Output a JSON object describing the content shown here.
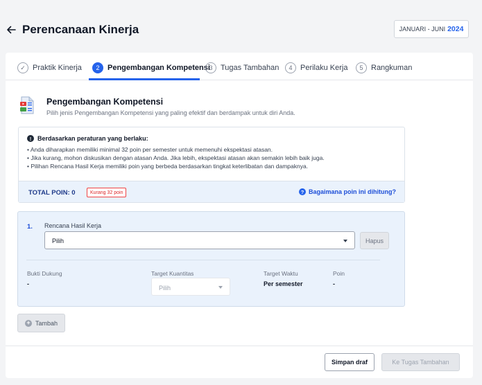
{
  "header": {
    "title": "Perencanaan Kinerja",
    "period_label": "JANUARI - JUNI",
    "period_year": "2024"
  },
  "steps": [
    {
      "marker": "✓",
      "label": "Praktik Kinerja",
      "state": "done"
    },
    {
      "marker": "2",
      "label": "Pengembangan Kompetensi",
      "state": "active"
    },
    {
      "marker": "3",
      "label": "Tugas Tambahan",
      "state": "pending"
    },
    {
      "marker": "4",
      "label": "Perilaku Kerja",
      "state": "pending"
    },
    {
      "marker": "5",
      "label": "Rangkuman",
      "state": "pending"
    }
  ],
  "section": {
    "icon": "document-media-icon",
    "title": "Pengembangan Kompetensi",
    "subtitle": "Pilih jenis Pengembangan Kompetensi yang paling efektif dan berdampak untuk diri Anda."
  },
  "rules": {
    "title": "Berdasarkan peraturan yang berlaku:",
    "items": [
      "Anda diharapkan memiliki minimal 32 poin per semester untuk memenuhi ekspektasi atasan.",
      "Jika kurang, mohon diskusikan dengan atasan Anda. Jika lebih, ekspektasi atasan akan semakin lebih baik juga.",
      "Pilihan Rencana Hasil Kerja memiliki poin yang berbeda berdasarkan tingkat keterlibatan dan dampaknya."
    ],
    "total_label": "TOTAL POIN: 0",
    "total_badge": "Kurang 32 poin",
    "help_link": "Bagaimana poin ini dihitung?"
  },
  "entry": {
    "number": "1.",
    "field_label": "Rencana Hasil Kerja",
    "select_value": "Pilih",
    "delete_label": "Hapus",
    "columns": {
      "evidence_label": "Bukti Dukung",
      "evidence_value": "-",
      "quantity_label": "Target Kuantitas",
      "quantity_value": "Pilih",
      "time_label": "Target Waktu",
      "time_value": "Per semester",
      "points_label": "Poin",
      "points_value": "-"
    }
  },
  "actions": {
    "add_label": "Tambah",
    "draft_label": "Simpan draf",
    "next_label": "Ke Tugas Tambahan"
  },
  "colors": {
    "accent": "#2563eb",
    "warning": "#dc2626",
    "panel": "#eaf2fc"
  }
}
